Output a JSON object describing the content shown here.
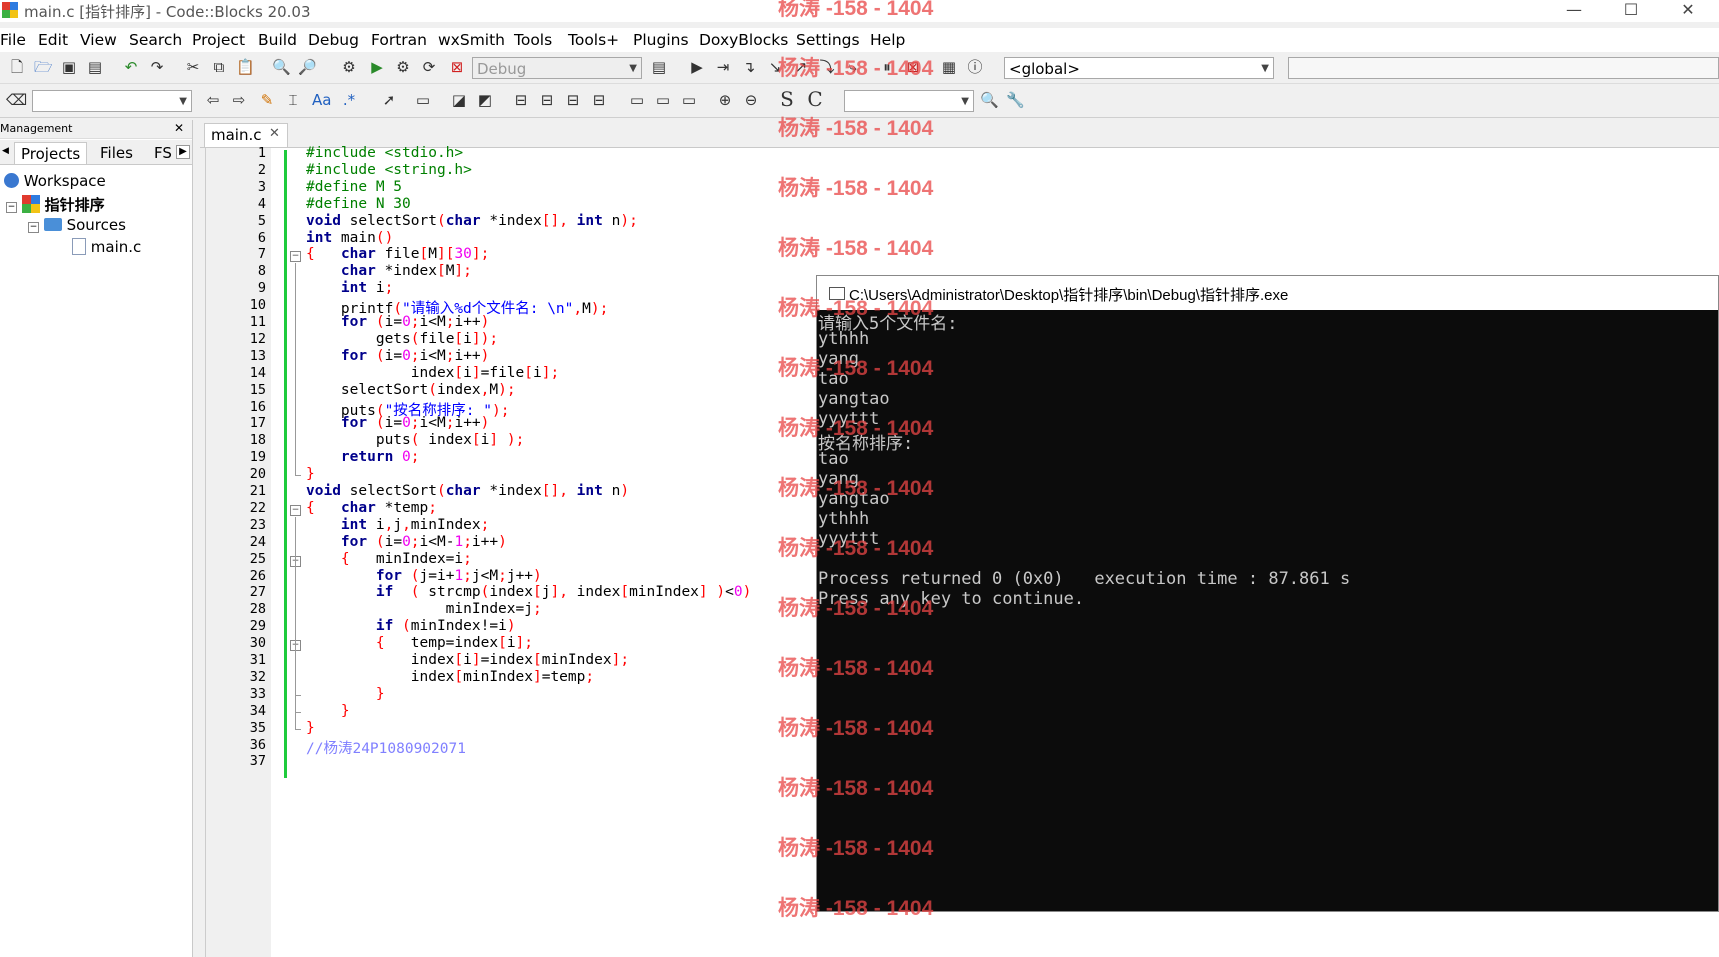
{
  "window": {
    "title": "main.c [指针排序] - Code::Blocks 20.03",
    "minimize": "—",
    "maximize": "☐",
    "close": "✕"
  },
  "menu": [
    "File",
    "Edit",
    "View",
    "Search",
    "Project",
    "Build",
    "Debug",
    "Fortran",
    "wxSmith",
    "Tools",
    "Tools+",
    "Plugins",
    "DoxyBlocks",
    "Settings",
    "Help"
  ],
  "toolbar": {
    "build_target": "Debug",
    "scope": "<global>",
    "search_text": "",
    "find_text": "",
    "icons": [
      "new-file-icon",
      "open-icon",
      "save-icon",
      "save-all-icon",
      "undo-icon",
      "redo-icon",
      "cut-icon",
      "copy-icon",
      "paste-icon",
      "find-icon",
      "replace-icon",
      "build-icon",
      "run-icon",
      "build-run-icon",
      "rebuild-icon",
      "abort-icon"
    ]
  },
  "management": {
    "header": "Management",
    "close": "✕",
    "tabs": [
      "Projects",
      "Files",
      "FS"
    ],
    "tree": {
      "workspace": "Workspace",
      "project": "指针排序",
      "folder": "Sources",
      "file": "main.c"
    }
  },
  "editor": {
    "tab_label": "main.c",
    "tab_close": "✕",
    "line_numbers": [
      "1",
      "2",
      "3",
      "4",
      "5",
      "6",
      "7",
      "8",
      "9",
      "10",
      "11",
      "12",
      "13",
      "14",
      "15",
      "16",
      "17",
      "18",
      "19",
      "20",
      "21",
      "22",
      "23",
      "24",
      "25",
      "26",
      "27",
      "28",
      "29",
      "30",
      "31",
      "32",
      "33",
      "34",
      "35",
      "36",
      "37"
    ],
    "code_lines": [
      "#include <stdio.h>",
      "#include <string.h>",
      "#define M 5",
      "#define N 30",
      "void selectSort(char *index[], int n);",
      "int main()",
      "{   char file[M][30];",
      "    char *index[M];",
      "    int i;",
      "    printf(\"请输入%d个文件名: \\n\",M);",
      "    for (i=0;i<M;i++)",
      "        gets(file[i]);",
      "    for (i=0;i<M;i++)",
      "            index[i]=file[i];",
      "    selectSort(index,M);",
      "    puts(\"按名称排序: \");",
      "    for (i=0;i<M;i++)",
      "        puts( index[i] );",
      "    return 0;",
      "}",
      "void selectSort(char *index[], int n)",
      "{   char *temp;",
      "    int i,j,minIndex;",
      "    for (i=0;i<M-1;i++)",
      "    {   minIndex=i;",
      "        for (j=i+1;j<M;j++)",
      "        if  ( strcmp(index[j], index[minIndex] )<0)",
      "                minIndex=j;",
      "        if (minIndex!=i)",
      "        {   temp=index[i];",
      "            index[i]=index[minIndex];",
      "            index[minIndex]=temp;",
      "        }",
      "    }",
      "}",
      "//杨涛24P1080902071",
      ""
    ]
  },
  "console": {
    "title": "C:\\Users\\Administrator\\Desktop\\指针排序\\bin\\Debug\\指针排序.exe",
    "lines": [
      "请输入5个文件名:",
      "ythhh",
      "yang",
      "tao",
      "yangtao",
      "yyyttt",
      "按名称排序:",
      "tao",
      "yang",
      "yangtao",
      "ythhh",
      "yyyttt",
      "",
      "Process returned 0 (0x0)   execution time : 87.861 s",
      "Press any key to continue."
    ]
  },
  "watermark": "杨涛 -158 - 1404",
  "colors": {
    "keyword": "#00008b",
    "preprocessor": "#008000",
    "number": "#f000f0",
    "string": "#0000ff",
    "comment": "#8080ff",
    "change_bar": "#1ecb3c",
    "watermark": "#e84646"
  }
}
